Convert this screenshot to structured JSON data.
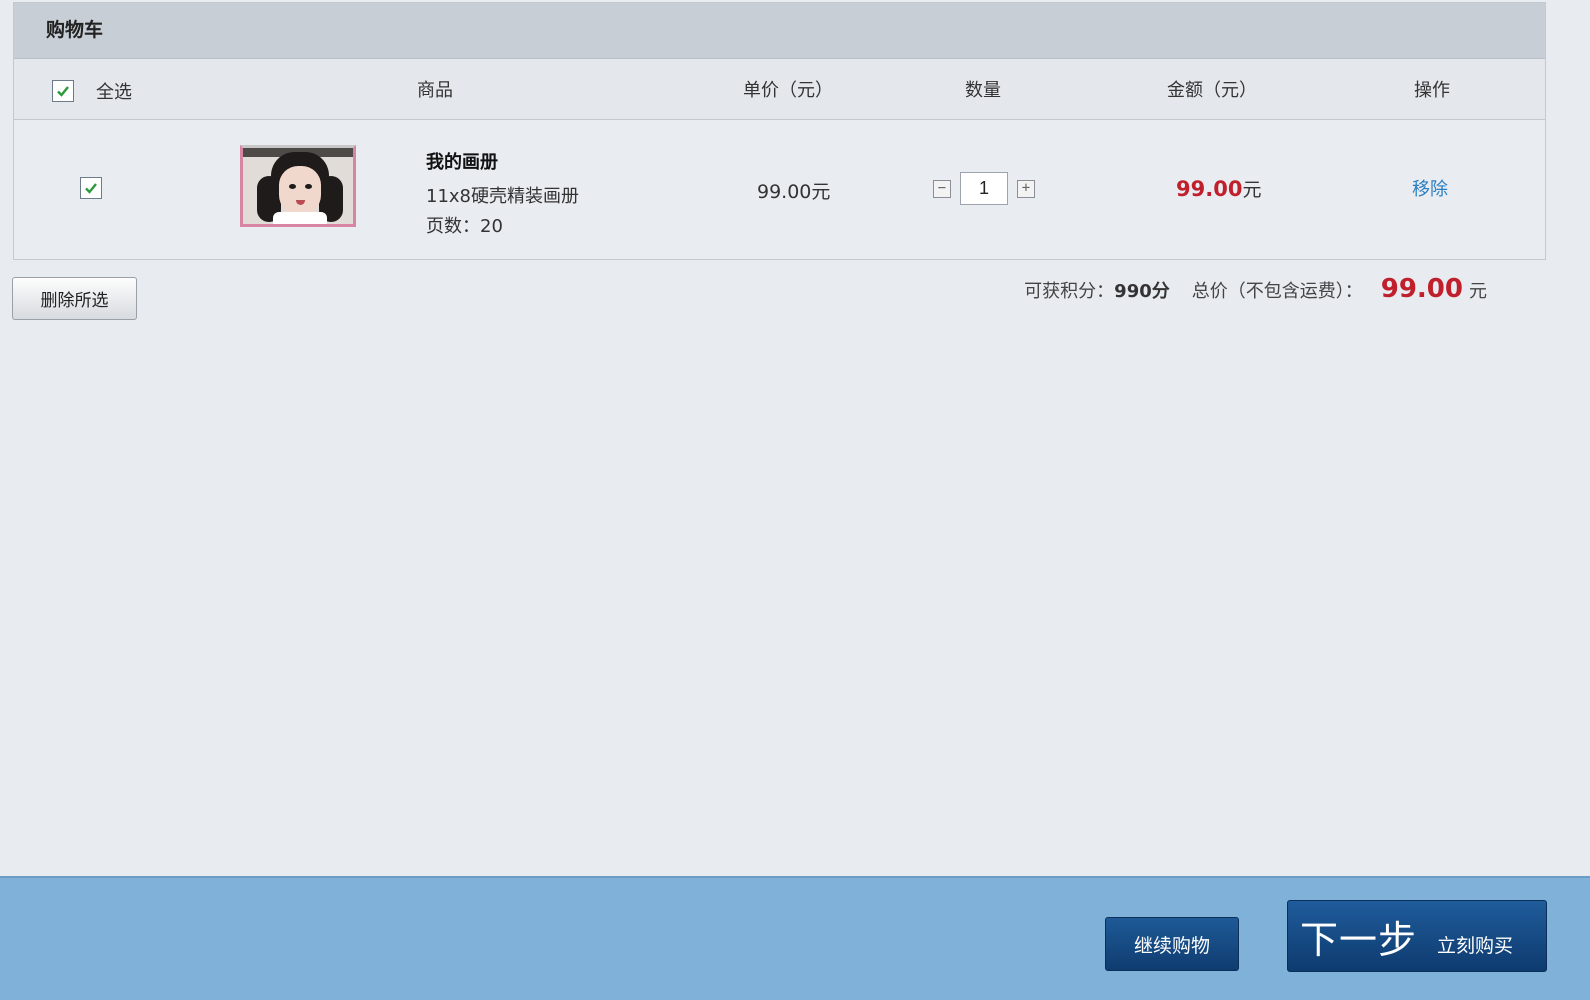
{
  "cart": {
    "title": "购物车",
    "header": {
      "select_all": "全选",
      "product": "商品",
      "unit_price": "单价（元）",
      "quantity": "数量",
      "amount": "金额（元）",
      "action": "操作"
    },
    "items": [
      {
        "checked": true,
        "name": "我的画册",
        "description": "11x8硬壳精装画册",
        "pages_label": "页数：20",
        "unit_price": "99.00元",
        "quantity": "1",
        "amount_value": "99.00",
        "amount_unit": "元",
        "remove_label": "移除"
      }
    ]
  },
  "actions": {
    "delete_selected": "删除所选",
    "continue_shopping": "继续购物",
    "next_step": "下一步",
    "buy_now": "立刻购买"
  },
  "summary": {
    "points_label": "可获积分：",
    "points_value": "990分",
    "total_label": "总价（不包含运费）：",
    "total_value": "99.00",
    "total_unit": "元"
  },
  "colors": {
    "accent_red": "#c0202b",
    "link_blue": "#2b7fc0",
    "footer_bg": "#80b1d9",
    "button_navy": "#0f3c70"
  }
}
